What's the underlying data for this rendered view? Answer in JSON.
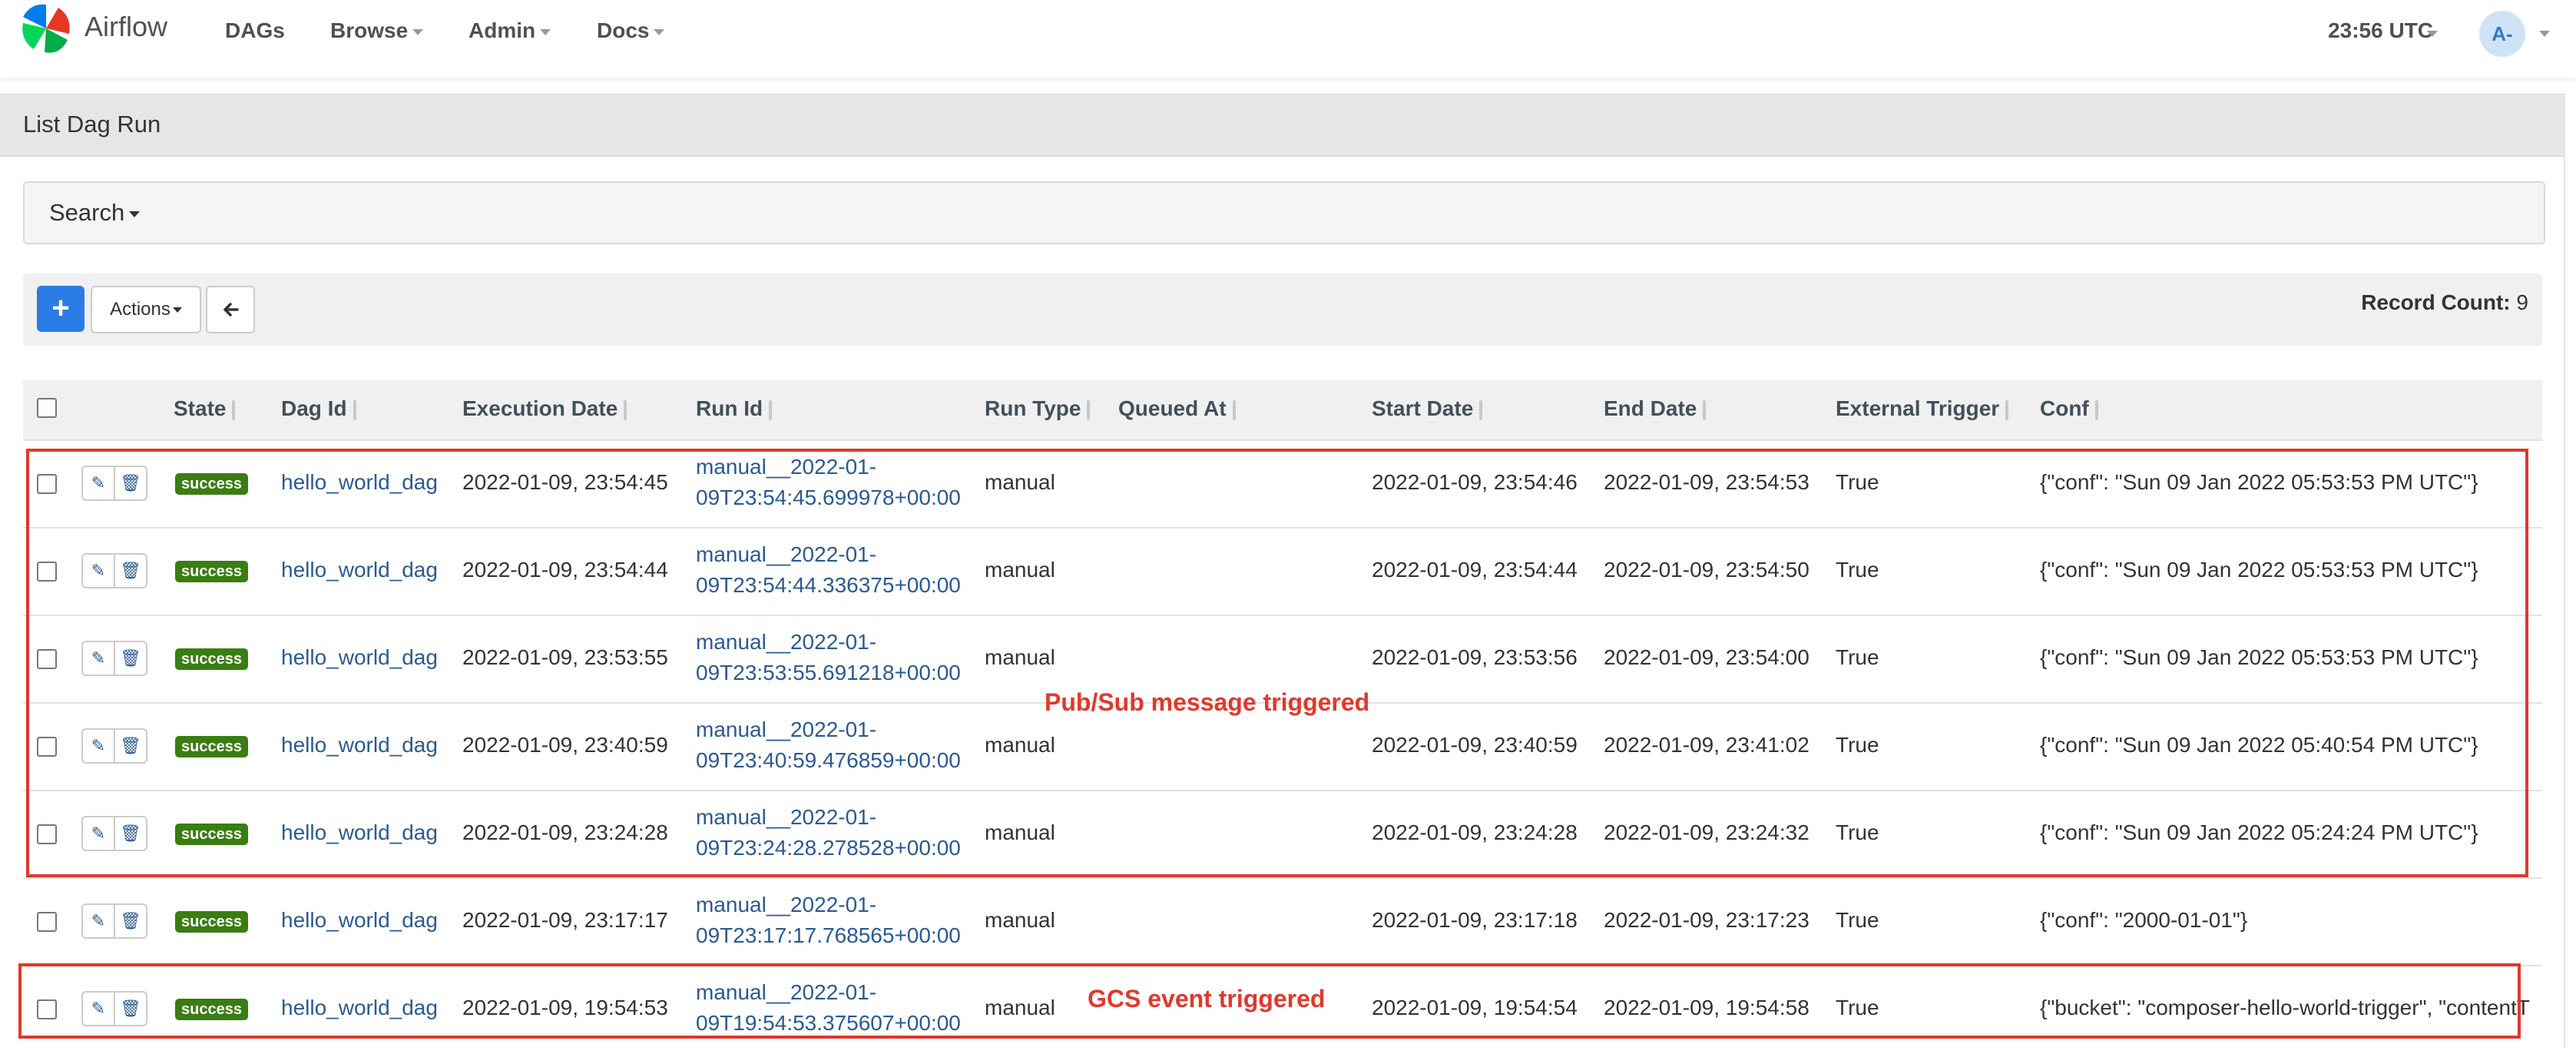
{
  "navbar": {
    "brand": "Airflow",
    "items": [
      "DAGs",
      "Browse",
      "Admin",
      "Docs"
    ],
    "clock": "23:56 UTC",
    "avatar": "A-"
  },
  "panel": {
    "title": "List Dag Run",
    "search_label": "Search",
    "actions_label": "Actions",
    "record_count_label": "Record Count:",
    "record_count": "9"
  },
  "table": {
    "columns": [
      "State",
      "Dag Id",
      "Execution Date",
      "Run Id",
      "Run Type",
      "Queued At",
      "Start Date",
      "End Date",
      "External Trigger",
      "Conf"
    ],
    "rows": [
      {
        "state": "success",
        "dag_id": "hello_world_dag",
        "execution_date": "2022-01-09, 23:54:45",
        "run_id_1": "manual__2022-01-",
        "run_id_2": "09T23:54:45.699978+00:00",
        "run_type": "manual",
        "queued_at": "",
        "start_date": "2022-01-09, 23:54:46",
        "end_date": "2022-01-09, 23:54:53",
        "external_trigger": "True",
        "conf": "{\"conf\": \"Sun 09 Jan 2022 05:53:53 PM UTC\"}"
      },
      {
        "state": "success",
        "dag_id": "hello_world_dag",
        "execution_date": "2022-01-09, 23:54:44",
        "run_id_1": "manual__2022-01-",
        "run_id_2": "09T23:54:44.336375+00:00",
        "run_type": "manual",
        "queued_at": "",
        "start_date": "2022-01-09, 23:54:44",
        "end_date": "2022-01-09, 23:54:50",
        "external_trigger": "True",
        "conf": "{\"conf\": \"Sun 09 Jan 2022 05:53:53 PM UTC\"}"
      },
      {
        "state": "success",
        "dag_id": "hello_world_dag",
        "execution_date": "2022-01-09, 23:53:55",
        "run_id_1": "manual__2022-01-",
        "run_id_2": "09T23:53:55.691218+00:00",
        "run_type": "manual",
        "queued_at": "",
        "start_date": "2022-01-09, 23:53:56",
        "end_date": "2022-01-09, 23:54:00",
        "external_trigger": "True",
        "conf": "{\"conf\": \"Sun 09 Jan 2022 05:53:53 PM UTC\"}"
      },
      {
        "state": "success",
        "dag_id": "hello_world_dag",
        "execution_date": "2022-01-09, 23:40:59",
        "run_id_1": "manual__2022-01-",
        "run_id_2": "09T23:40:59.476859+00:00",
        "run_type": "manual",
        "queued_at": "",
        "start_date": "2022-01-09, 23:40:59",
        "end_date": "2022-01-09, 23:41:02",
        "external_trigger": "True",
        "conf": "{\"conf\": \"Sun 09 Jan 2022 05:40:54 PM UTC\"}"
      },
      {
        "state": "success",
        "dag_id": "hello_world_dag",
        "execution_date": "2022-01-09, 23:24:28",
        "run_id_1": "manual__2022-01-",
        "run_id_2": "09T23:24:28.278528+00:00",
        "run_type": "manual",
        "queued_at": "",
        "start_date": "2022-01-09, 23:24:28",
        "end_date": "2022-01-09, 23:24:32",
        "external_trigger": "True",
        "conf": "{\"conf\": \"Sun 09 Jan 2022 05:24:24 PM UTC\"}"
      },
      {
        "state": "success",
        "dag_id": "hello_world_dag",
        "execution_date": "2022-01-09, 23:17:17",
        "run_id_1": "manual__2022-01-",
        "run_id_2": "09T23:17:17.768565+00:00",
        "run_type": "manual",
        "queued_at": "",
        "start_date": "2022-01-09, 23:17:18",
        "end_date": "2022-01-09, 23:17:23",
        "external_trigger": "True",
        "conf": "{\"conf\": \"2000-01-01\"}"
      },
      {
        "state": "success",
        "dag_id": "hello_world_dag",
        "execution_date": "2022-01-09, 19:54:53",
        "run_id_1": "manual__2022-01-",
        "run_id_2": "09T19:54:53.375607+00:00",
        "run_type": "manual",
        "queued_at": "",
        "start_date": "2022-01-09, 19:54:54",
        "end_date": "2022-01-09, 19:54:58",
        "external_trigger": "True",
        "conf": "{\"bucket\": \"composer-hello-world-trigger\", \"contentT"
      }
    ]
  },
  "annotations": {
    "pubsub": "Pub/Sub message triggered",
    "gcs": "GCS event triggered"
  },
  "colors": {
    "accent": "#2a7be4",
    "success": "#3a7d12",
    "link": "#2a5a93",
    "annotation_red": "#e0392b"
  }
}
